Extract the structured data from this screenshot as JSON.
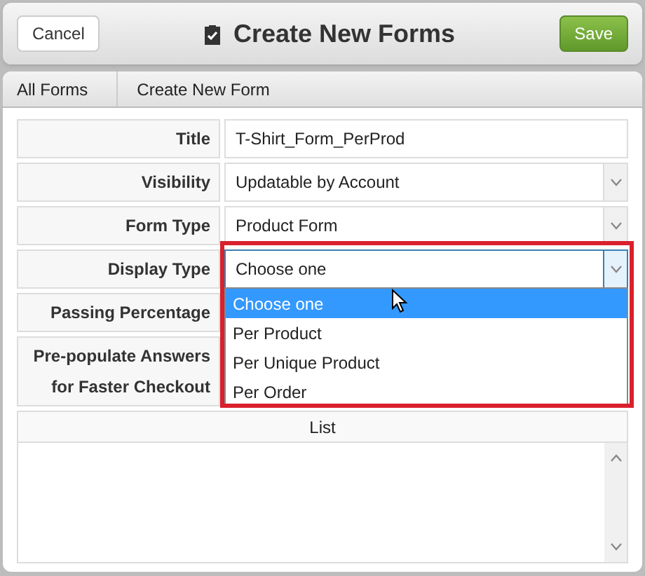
{
  "header": {
    "cancel": "Cancel",
    "title": "Create New Forms",
    "save": "Save"
  },
  "breadcrumbs": [
    "All Forms",
    "Create New Form"
  ],
  "fields": [
    {
      "label": "Title",
      "kind": "text",
      "value": "T-Shirt_Form_PerProd"
    },
    {
      "label": "Visibility",
      "kind": "select",
      "value": "Updatable by Account"
    },
    {
      "label": "Form Type",
      "kind": "select",
      "value": "Product Form"
    },
    {
      "label": "Display Type",
      "kind": "select",
      "value": "Choose one",
      "expanded": true,
      "options": [
        {
          "label": "Choose one",
          "selected": true
        },
        {
          "label": "Per Product",
          "selected": false
        },
        {
          "label": "Per Unique Product",
          "selected": false
        },
        {
          "label": "Per Order",
          "selected": false
        }
      ]
    },
    {
      "label": "Passing Percentage",
      "kind": "hidden"
    },
    {
      "label": "Pre-populate Answers for Faster Checkout",
      "kind": "hidden"
    }
  ],
  "list": {
    "heading": "List"
  }
}
